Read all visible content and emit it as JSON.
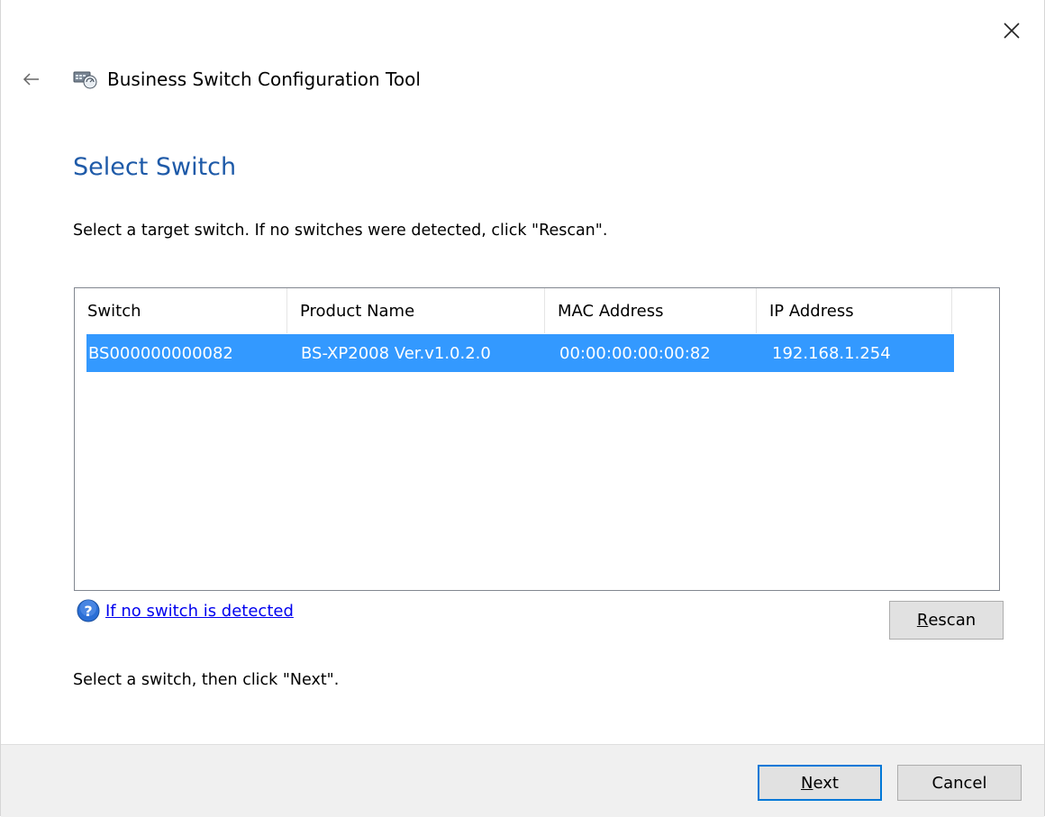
{
  "window": {
    "title": "Business Switch Configuration Tool",
    "close_icon": "close-icon",
    "back_icon": "back-arrow-icon",
    "app_icon": "network-switch-icon"
  },
  "page": {
    "title": "Select Switch",
    "instruction": "Select a target switch. If no switches were detected, click \"Rescan\".",
    "footer_instruction": "Select a switch, then click \"Next\"."
  },
  "switch_list": {
    "columns": [
      "Switch",
      "Product Name",
      "MAC Address",
      "IP Address"
    ],
    "rows": [
      {
        "switch": "BS000000000082",
        "product_name": "BS-XP2008 Ver.v1.0.2.0",
        "mac_address": "00:00:00:00:00:82",
        "ip_address": "192.168.1.254",
        "selected": true
      }
    ]
  },
  "help": {
    "icon": "help-icon",
    "link_text": "If no switch is detected"
  },
  "buttons": {
    "rescan": {
      "mnemonic": "R",
      "rest": "escan"
    },
    "next": {
      "mnemonic": "N",
      "rest": "ext"
    },
    "cancel": "Cancel"
  },
  "colors": {
    "accent_title": "#1e5aa8",
    "selection": "#3399ff",
    "link": "#0000ee",
    "default_button_border": "#0078d7"
  }
}
